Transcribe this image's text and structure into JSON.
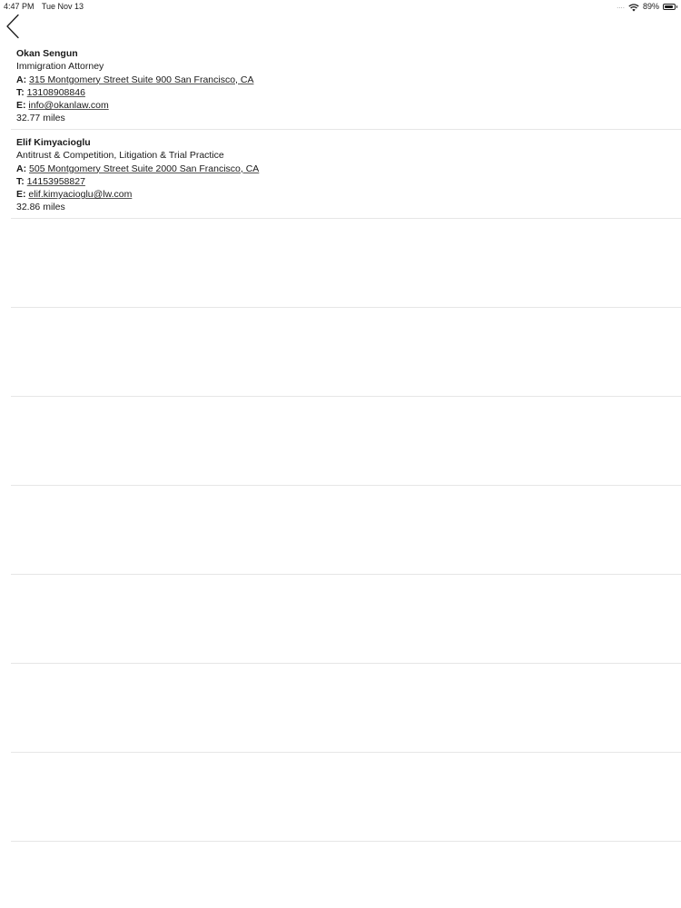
{
  "status_bar": {
    "time": "4:47 PM",
    "date": "Tue Nov 13",
    "signal": "....",
    "battery_text": "89%",
    "battery_level": 0.89
  },
  "attorneys": [
    {
      "name": "Okan Sengun",
      "specialty": "Immigration Attorney",
      "address_label": "A:",
      "address": "315 Montgomery Street Suite 900 San Francisco, CA",
      "phone_label": "T:",
      "phone": "13108908846",
      "email_label": "E:",
      "email": "info@okanlaw.com",
      "distance": "32.77 miles"
    },
    {
      "name": "Elif Kimyacioglu",
      "specialty": "Antitrust & Competition, Litigation & Trial Practice",
      "address_label": "A:",
      "address": "505 Montgomery Street Suite 2000 San Francisco, CA",
      "phone_label": "T:",
      "phone": "14153958827",
      "email_label": "E:",
      "email": "elif.kimyacioglu@lw.com",
      "distance": "32.86 miles"
    }
  ]
}
